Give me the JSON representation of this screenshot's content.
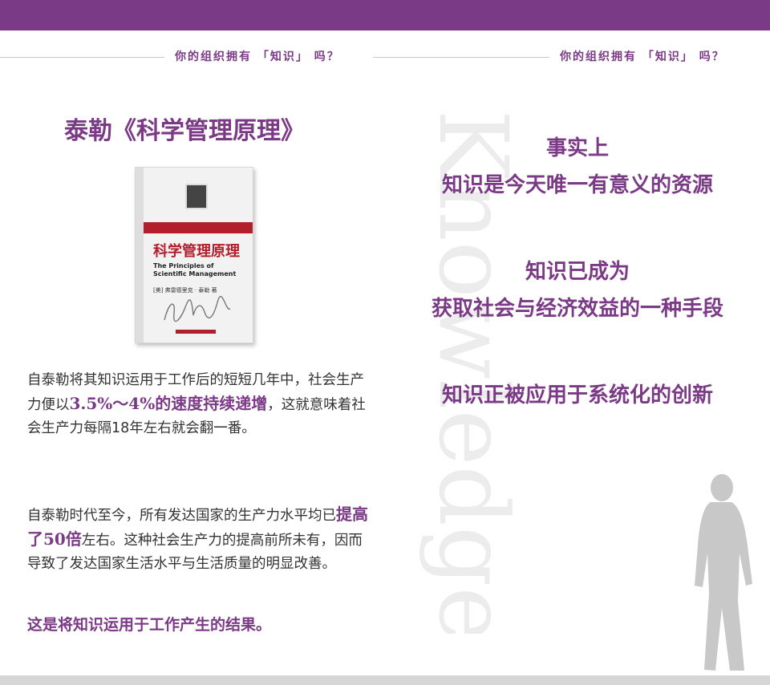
{
  "header": {
    "left_caption": "你的组织拥有 「知识」 吗？",
    "right_caption": "你的组织拥有 「知识」 吗？"
  },
  "watermark": {
    "text": "Knowledge"
  },
  "left": {
    "title": "泰勒《科学管理原理》",
    "book_cover": {
      "title_cn": "科学管理原理",
      "title_en": "The Principles of Scientific Management",
      "author": "[美] 弗雷德里克 · 泰勒 著"
    },
    "para1": {
      "pre": "自泰勒将其知识运用于工作后的短短几年中，社会生产力便以",
      "highlight": "3.5%～4%的速度持续递增",
      "post": "，这就意味着社会生产力每隔18年左右就会翻一番。"
    },
    "para2": {
      "pre": "自泰勒时代至今，所有发达国家的生产力水平均已",
      "highlight": "提高了50倍",
      "post": "左右。这种社会生产力的提高前所未有，因而导致了发达国家生活水平与生活质量的明显改善。"
    },
    "conclusion": "这是将知识运用于工作产生的结果。"
  },
  "right": {
    "line1": "事实上",
    "line2": "知识是今天唯一有意义的资源",
    "line3": "知识已成为",
    "line4": "获取社会与经济效益的一种手段",
    "line5": "知识正被应用于系统化的创新"
  },
  "colors": {
    "accent": "#7b3a86",
    "bar": "#7b3a86",
    "text": "#333333"
  }
}
